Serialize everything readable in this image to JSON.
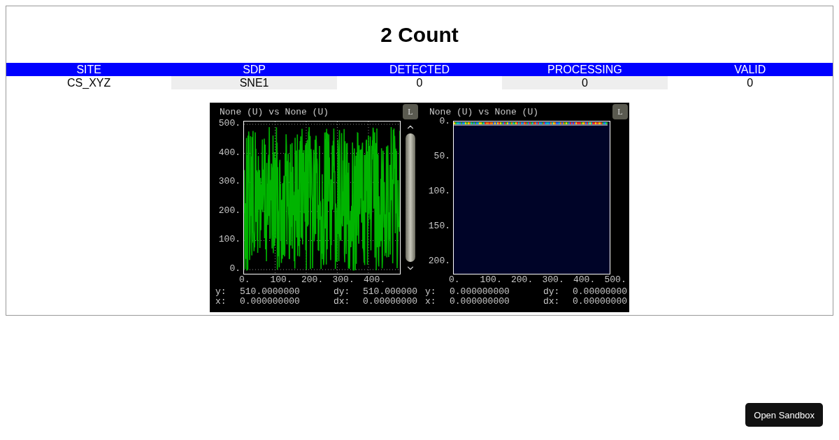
{
  "title": "2 Count",
  "table": {
    "columns": [
      "SITE",
      "SDP",
      "DETECTED",
      "PROCESSING",
      "VALID"
    ],
    "rows": [
      [
        "CS_XYZ",
        "SNE1",
        "0",
        "0",
        "0"
      ]
    ]
  },
  "plots": [
    {
      "kind": "line",
      "title": "None (U) vs None (U)",
      "button": "L",
      "yticks": [
        "500.",
        "400.",
        "300.",
        "200.",
        "100.",
        "0."
      ],
      "xticks": [
        "0.",
        "100.",
        "200.",
        "300.",
        "400."
      ],
      "readout": [
        [
          {
            "label": "y:",
            "value": "510.0000000"
          },
          {
            "label": "dy:",
            "value": "510.000000"
          }
        ],
        [
          {
            "label": "x:",
            "value": "0.000000000"
          },
          {
            "label": "dx:",
            "value": "0.00000000"
          }
        ]
      ]
    },
    {
      "kind": "image",
      "title": "None (U) vs None (U)",
      "button": "L",
      "yticks": [
        "0.",
        "50.",
        "100.",
        "150.",
        "200."
      ],
      "xticks": [
        "0.",
        "100.",
        "200.",
        "300.",
        "400.",
        "500."
      ],
      "readout": [
        [
          {
            "label": "y:",
            "value": "0.000000000"
          },
          {
            "label": "dy:",
            "value": "0.00000000"
          }
        ],
        [
          {
            "label": "x:",
            "value": "0.000000000"
          },
          {
            "label": "dx:",
            "value": "0.00000000"
          }
        ]
      ]
    }
  ],
  "sandbox_button": "Open Sandbox"
}
